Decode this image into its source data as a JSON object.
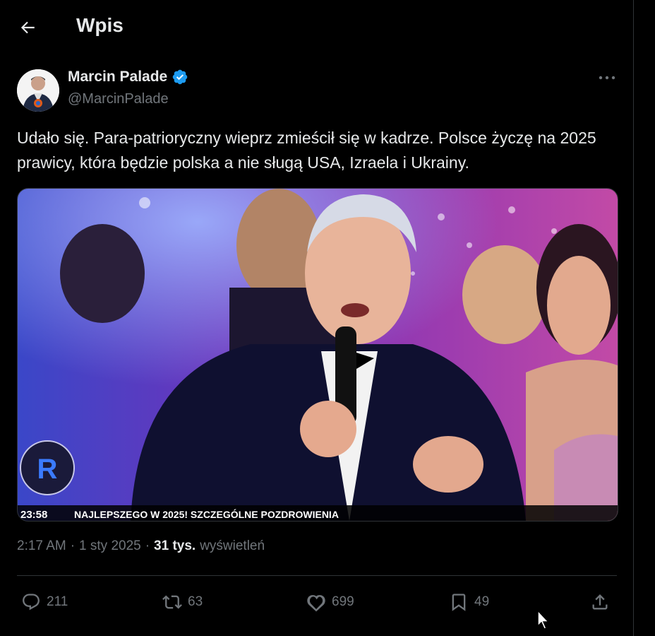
{
  "header": {
    "title": "Wpis"
  },
  "author": {
    "name": "Marcin Palade",
    "handle": "@MarcinPalade"
  },
  "post": {
    "text": "Udało się. Para-patrioryczny wieprz zmieścił się w kadrze. Polsce życzę na 2025 prawicy, która będzie polska a nie sługą USA, Izraela i Ukrainy.",
    "time": "2:17 AM",
    "separator1": "·",
    "date": "1 sty 2025",
    "separator2": "·",
    "views_count": "31 tys.",
    "views_label": "wyświetleń"
  },
  "media": {
    "clock": "23:58",
    "ticker": "NAJLEPSZEGO W 2025! SZCZEGÓLNE POZDROWIENIA"
  },
  "actions": {
    "replies": "211",
    "reposts": "63",
    "likes": "699",
    "bookmarks": "49"
  },
  "colors": {
    "accent": "#1d9bf0",
    "muted": "#71767b",
    "text": "#e7e9ea",
    "border": "#2f3336"
  }
}
